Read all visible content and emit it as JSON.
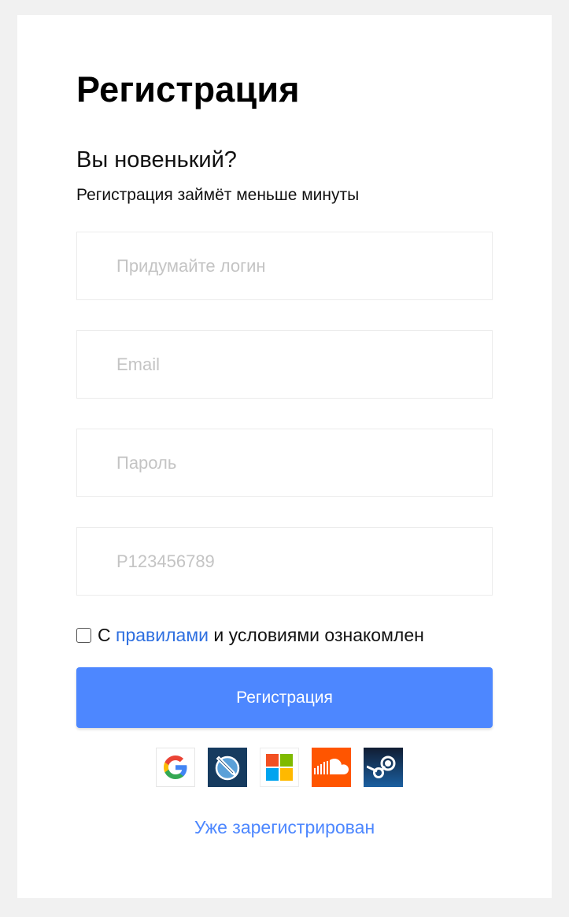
{
  "card": {
    "title": "Регистрация",
    "subtitle": "Вы новенький?",
    "hint": "Регистрация займёт меньше минуты"
  },
  "fields": {
    "login_placeholder": "Придумайте логин",
    "email_placeholder": "Email",
    "password_placeholder": "Пароль",
    "code_placeholder": "P123456789"
  },
  "terms": {
    "prefix": "С",
    "link": "правилами",
    "suffix": "и условиями ознакомлен",
    "checked": false
  },
  "submit_label": "Регистрация",
  "social_icons": [
    "google-icon",
    "osu-pencil-icon",
    "microsoft-icon",
    "soundcloud-icon",
    "steam-icon"
  ],
  "login_link": "Уже зарегистрирован",
  "colors": {
    "accent": "#4d87ff",
    "link": "#2e6fe0",
    "page_bg": "#f1f1f1"
  }
}
